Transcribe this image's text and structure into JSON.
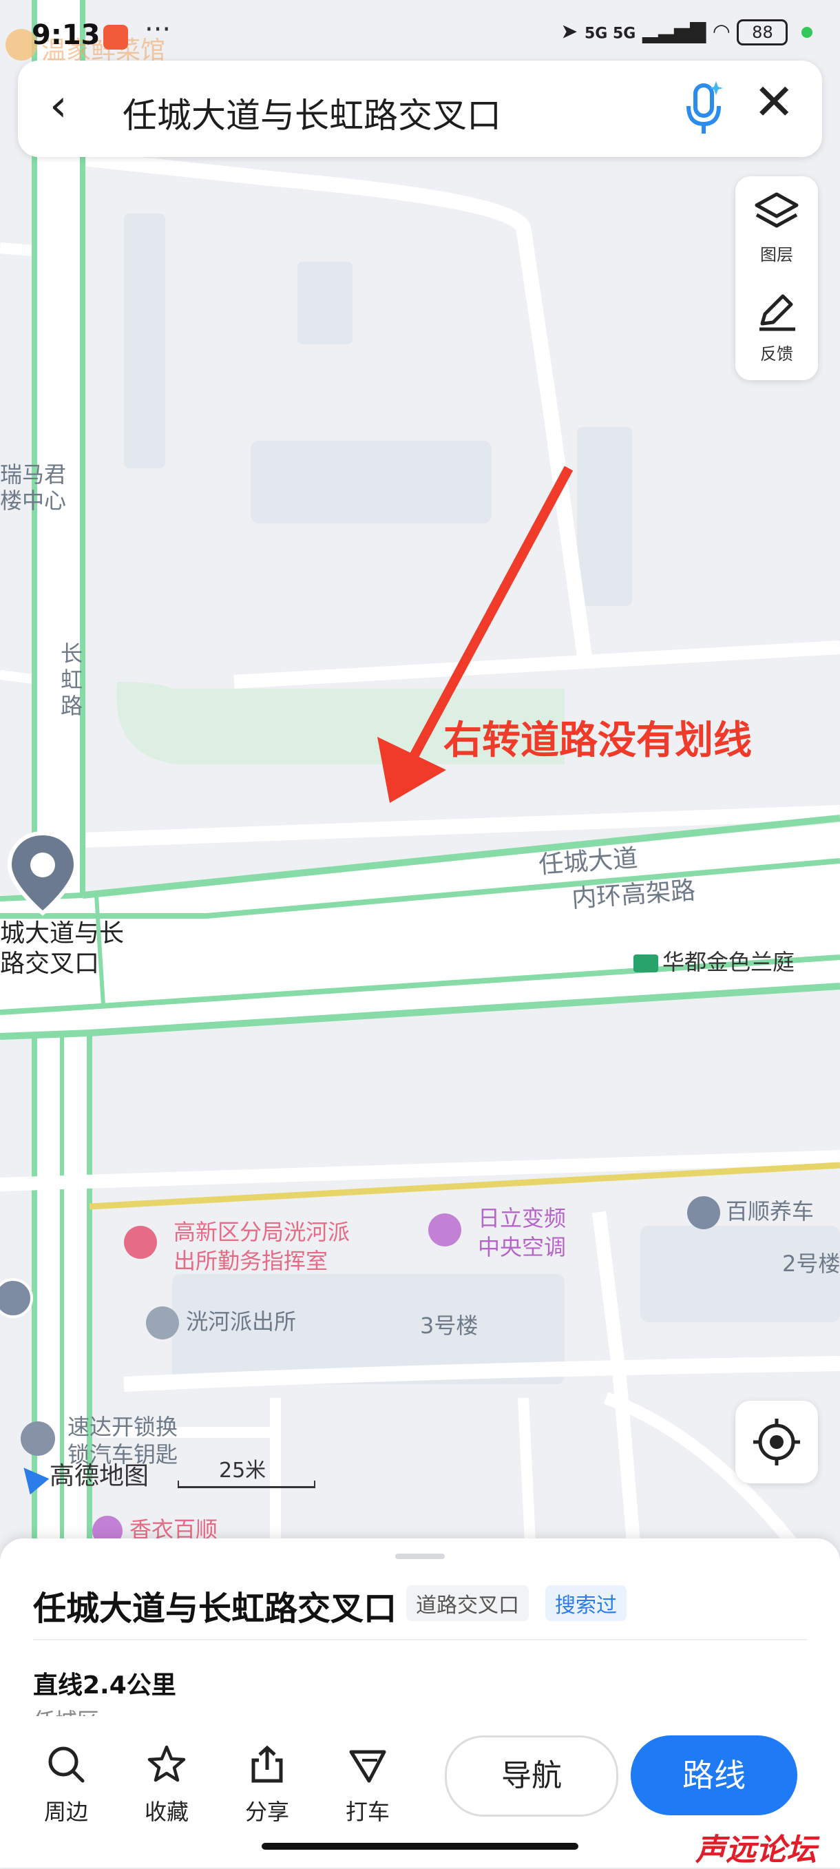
{
  "status_bar": {
    "time": "9:13",
    "dots": "···",
    "ghost_text": "温家鲜菜馆",
    "network": "5G 5G",
    "battery": "88"
  },
  "search": {
    "query": "任城大道与长虹路交叉口",
    "back_icon": "chevron-left-icon",
    "voice_icon": "microphone-icon",
    "close_icon": "close-icon"
  },
  "tools": {
    "layers_label": "图层",
    "feedback_label": "反馈"
  },
  "map": {
    "annotation": "右转道路没有划线",
    "labels": {
      "ruima": "瑞马君",
      "louzhongxin": "楼中心",
      "changhong": "长虹路",
      "rencheng": "任城大道",
      "neihuan": "内环高架路",
      "huadu": "华都金色兰庭",
      "police_hq1": "高新区分局洸河派",
      "police_hq2": "出所勤务指挥室",
      "hitachi1": "日立变频",
      "hitachi2": "中央空调",
      "baishun": "百顺养车",
      "bldg2": "2号楼",
      "police": "洸河派出所",
      "bldg3": "3号楼",
      "locksmith1": "速达开锁换",
      "locksmith2": "锁汽车钥匙",
      "xiangyi": "香衣百顺"
    },
    "pin_label_line1": "城大道与长",
    "pin_label_line2": "路交叉口",
    "logo": "高德地图",
    "scale": "25米"
  },
  "place": {
    "title": "任城大道与长虹路交叉口",
    "tag_type": "道路交叉口",
    "tag_searched": "搜索过",
    "distance": "直线2.4公里",
    "district": "任城区"
  },
  "actions": {
    "nearby": "周边",
    "favorite": "收藏",
    "share": "分享",
    "taxi": "打车",
    "navigate": "导航",
    "route": "路线"
  },
  "watermark": "声远论坛",
  "colors": {
    "accent": "#1e7bf5",
    "road_edge": "#7fd9a2",
    "annotation": "#f03a2a",
    "expressway": "#e7d56a"
  }
}
